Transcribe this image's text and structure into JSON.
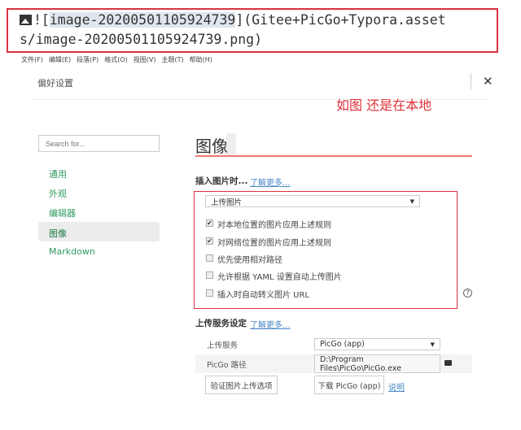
{
  "code": {
    "prefix": "![",
    "alt": "image-20200501105924739",
    "line1_rest": "](Gitee+PicGo+Typora.asset",
    "line2": "s/image-20200501105924739.png)"
  },
  "menu": [
    "文件(F)",
    "编辑(E)",
    "段落(P)",
    "格式(O)",
    "视图(V)",
    "主题(T)",
    "帮助(H)"
  ],
  "header": {
    "title": "偏好设置",
    "close": "✕"
  },
  "annotation": "如图 还是在本地",
  "search": {
    "placeholder": "Search for..."
  },
  "sidebar": {
    "items": [
      {
        "label": "通用"
      },
      {
        "label": "外观"
      },
      {
        "label": "编辑器"
      },
      {
        "label": "图像",
        "active": true
      },
      {
        "label": "Markdown"
      }
    ]
  },
  "section": {
    "title": "图像"
  },
  "insert": {
    "label": "插入图片时...",
    "link": "了解更多...",
    "select": "上传图片",
    "options": [
      {
        "label": "对本地位置的图片应用上述规则",
        "checked": true
      },
      {
        "label": "对网络位置的图片应用上述规则",
        "checked": true
      },
      {
        "label": "优先使用相对路径",
        "checked": false
      },
      {
        "label": "允许根据 YAML 设置自动上传图片",
        "checked": false
      },
      {
        "label": "插入时自动转义图片 URL",
        "checked": false
      }
    ],
    "help": "?"
  },
  "upload": {
    "label": "上传服务设定",
    "link": "了解更多...",
    "service_label": "上传服务",
    "service_value": "PicGo (app)",
    "path_label": "PicGo 路径",
    "path_value": "D:\\Program Files\\PicGo\\PicGo.exe",
    "verify_button": "验证图片上传选项",
    "download_button": "下载 PicGo (app)",
    "help_link": "说明"
  },
  "colors": {
    "accent": "#d9333f",
    "sidebar": "#2f9a5f",
    "link": "#4a86c5"
  }
}
